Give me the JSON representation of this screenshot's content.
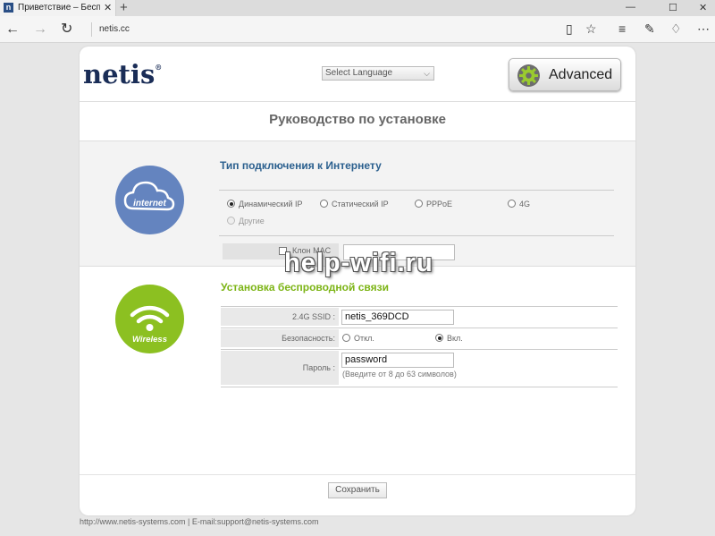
{
  "browser": {
    "tab_title": "Приветствие – Беспроводн",
    "tab_favicon": "n",
    "close_glyph": "✕",
    "new_tab_glyph": "+",
    "url": "netis.cc"
  },
  "header": {
    "logo": "netis",
    "logo_mark": "®",
    "language_select": "Select Language",
    "advanced_button": "Advanced"
  },
  "page_title": "Руководство по установке",
  "internet_section": {
    "icon_label": "internet",
    "title": "Тип подключения к Интернету",
    "options": [
      {
        "label": "Динамический IP",
        "selected": true,
        "disabled": false
      },
      {
        "label": "Статический IP",
        "selected": false,
        "disabled": false
      },
      {
        "label": "PPPoE",
        "selected": false,
        "disabled": false
      },
      {
        "label": "4G",
        "selected": false,
        "disabled": false
      },
      {
        "label": "Другие",
        "selected": false,
        "disabled": true
      }
    ],
    "mac_clone_label": "Клон MAC",
    "mac_clone_value": ""
  },
  "wireless_section": {
    "icon_label": "Wireless",
    "title": "Установка беспроводной связи",
    "ssid_label": "2.4G SSID :",
    "ssid_value": "netis_369DCD",
    "security_label": "Безопасность:",
    "security_off": "Откл.",
    "security_on": "Вкл.",
    "security_selected": "on",
    "password_label": "Пароль :",
    "password_value": "password",
    "password_hint": "(Введите от 8 до 63 символов)"
  },
  "save_button": "Сохранить",
  "footer": "http://www.netis-systems.com | E-mail:support@netis-systems.com",
  "watermark": "help-wifi.ru",
  "colors": {
    "logo": "#1a2d57",
    "internet_circle": "#6484bf",
    "wireless_circle": "#8cc021",
    "internet_title": "#2a5f8e",
    "wireless_title": "#7cb415"
  }
}
